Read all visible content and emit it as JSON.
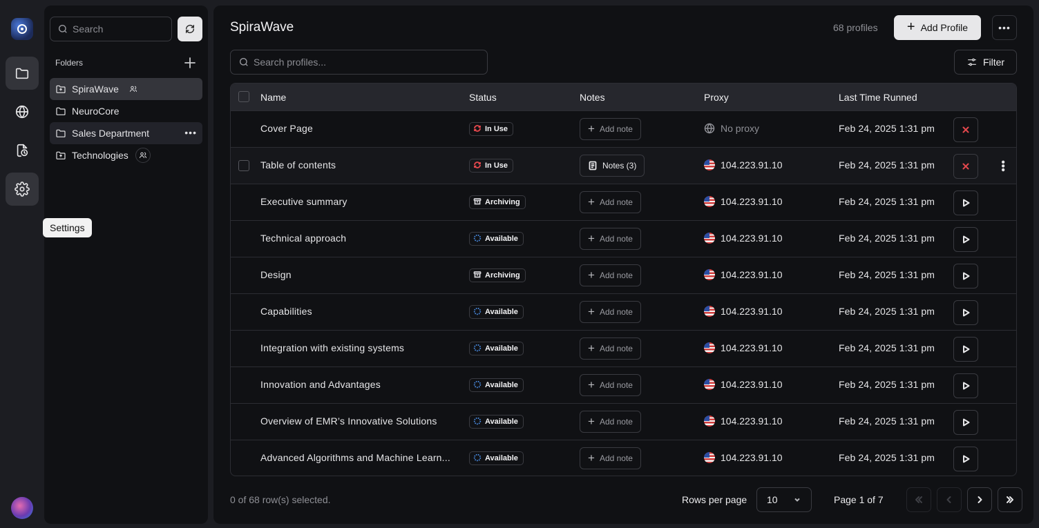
{
  "rail": {
    "tooltip": "Settings"
  },
  "folders": {
    "search_placeholder": "Search",
    "section_label": "Folders",
    "items": [
      {
        "label": "SpiraWave",
        "shared": true
      },
      {
        "label": "NeuroCore",
        "shared": false
      },
      {
        "label": "Sales Department",
        "shared": false
      },
      {
        "label": "Technologies",
        "shared": true
      }
    ]
  },
  "header": {
    "title": "SpiraWave",
    "profile_count": "68 profiles",
    "add_label": "Add Profile",
    "search_placeholder": "Search profiles...",
    "filter_label": "Filter"
  },
  "table": {
    "columns": [
      "Name",
      "Status",
      "Notes",
      "Proxy",
      "Last Time Runned"
    ],
    "rows": [
      {
        "name": "Cover Page",
        "status": "In Use",
        "note": "Add note",
        "proxy": "No proxy",
        "last": "Feb 24, 2025 1:31 pm",
        "action": "stop"
      },
      {
        "name": "Table of contents",
        "status": "In Use",
        "note": "Notes (3)",
        "proxy": "104.223.91.10",
        "last": "Feb 24, 2025 1:31 pm",
        "action": "stop"
      },
      {
        "name": "Executive summary",
        "status": "Archiving",
        "note": "Add note",
        "proxy": "104.223.91.10",
        "last": "Feb 24, 2025 1:31 pm",
        "action": "play"
      },
      {
        "name": "Technical approach",
        "status": "Available",
        "note": "Add note",
        "proxy": "104.223.91.10",
        "last": "Feb 24, 2025 1:31 pm",
        "action": "play"
      },
      {
        "name": "Design",
        "status": "Archiving",
        "note": "Add note",
        "proxy": "104.223.91.10",
        "last": "Feb 24, 2025 1:31 pm",
        "action": "play"
      },
      {
        "name": "Capabilities",
        "status": "Available",
        "note": "Add note",
        "proxy": "104.223.91.10",
        "last": "Feb 24, 2025 1:31 pm",
        "action": "play"
      },
      {
        "name": "Integration with existing systems",
        "status": "Available",
        "note": "Add note",
        "proxy": "104.223.91.10",
        "last": "Feb 24, 2025 1:31 pm",
        "action": "play"
      },
      {
        "name": "Innovation and Advantages",
        "status": "Available",
        "note": "Add note",
        "proxy": "104.223.91.10",
        "last": "Feb 24, 2025 1:31 pm",
        "action": "play"
      },
      {
        "name": "Overview of EMR’s Innovative Solutions",
        "status": "Available",
        "note": "Add note",
        "proxy": "104.223.91.10",
        "last": "Feb 24, 2025 1:31 pm",
        "action": "play"
      },
      {
        "name": "Advanced Algorithms and Machine Learn...",
        "status": "Available",
        "note": "Add note",
        "proxy": "104.223.91.10",
        "last": "Feb 24, 2025 1:31 pm",
        "action": "play"
      }
    ]
  },
  "footer": {
    "selection": "0 of 68 row(s) selected.",
    "rows_per_page_label": "Rows per page",
    "rows_per_page_value": "10",
    "page_info": "Page 1 of 7"
  },
  "colors": {
    "accent_red": "#e5484d",
    "in_use_icon": "#e5484d",
    "archiving_icon": "#d0d0d4",
    "available_icon": "#4a8fe8"
  },
  "icons": {
    "in_use": "refresh-icon",
    "archiving": "archive-icon",
    "available": "loader-icon"
  }
}
